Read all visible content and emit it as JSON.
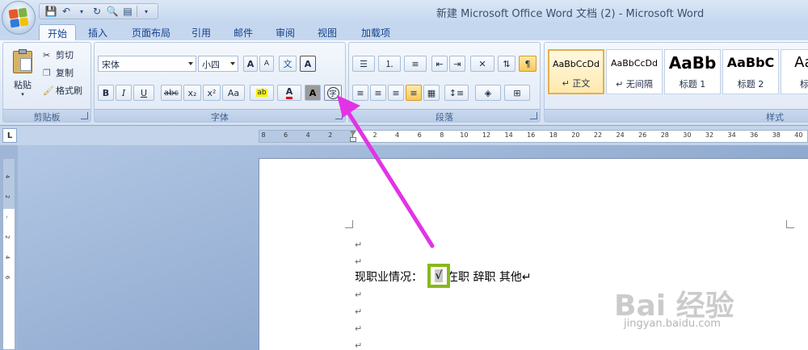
{
  "window": {
    "title": "新建 Microsoft Office Word 文档 (2) - Microsoft Word"
  },
  "tabs": [
    {
      "label": "开始",
      "active": true
    },
    {
      "label": "插入"
    },
    {
      "label": "页面布局"
    },
    {
      "label": "引用"
    },
    {
      "label": "邮件"
    },
    {
      "label": "审阅"
    },
    {
      "label": "视图"
    },
    {
      "label": "加载项"
    }
  ],
  "clipboard": {
    "paste": "粘贴",
    "cut": "剪切",
    "copy": "复制",
    "format_painter": "格式刷",
    "group_label": "剪贴板"
  },
  "font": {
    "font_name": "宋体",
    "font_size": "小四",
    "grow": "A",
    "shrink": "A",
    "phonetic": "文",
    "border_char": "A",
    "bold": "B",
    "italic": "I",
    "underline": "U",
    "strike": "abc",
    "subscript": "x₂",
    "superscript": "x²",
    "change_case": "Aa",
    "highlight": "ab",
    "font_color": "A",
    "char_shading": "A",
    "enclose_char": "字",
    "group_label": "字体"
  },
  "paragraph": {
    "group_label": "段落"
  },
  "styles": {
    "items": [
      {
        "sample": "AaBbCcDd",
        "name": "↵ 正文"
      },
      {
        "sample": "AaBbCcDd",
        "name": "↵ 无间隔"
      },
      {
        "sample": "AaBb",
        "name": "标题 1"
      },
      {
        "sample": "AaBbC",
        "name": "标题 2"
      },
      {
        "sample": "AaB",
        "name": "标题"
      }
    ],
    "group_label": "样式"
  },
  "ruler": {
    "corner": "L",
    "labels": [
      "8",
      "6",
      "4",
      "2",
      "",
      "2",
      "4",
      "6",
      "8",
      "10",
      "12",
      "14",
      "16",
      "18",
      "20",
      "22",
      "24",
      "26",
      "28",
      "30",
      "32",
      "34",
      "36",
      "38",
      "40"
    ]
  },
  "vruler": {
    "labels": [
      "4",
      "2",
      "",
      "2",
      "4",
      "6"
    ]
  },
  "document": {
    "para_mark": "↵",
    "line_prefix": "现职业情况：",
    "checked_char": "√",
    "line_rest": "在职 辞职 其他↵"
  },
  "watermark": {
    "main": "Bai 经验",
    "sub": "jingyan.baidu.com"
  },
  "colors": {
    "arrow": "#e233e6",
    "highlight_box": "#86b91a"
  }
}
